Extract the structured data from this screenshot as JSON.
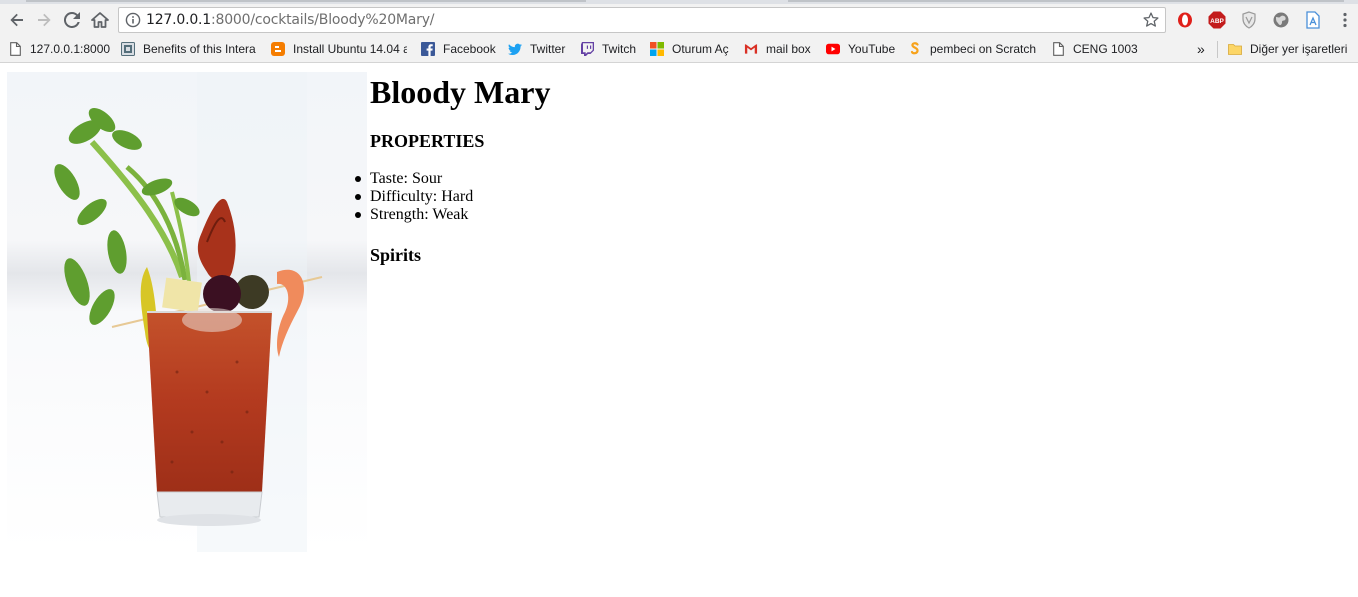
{
  "browser": {
    "url_host": "127.0.0.1",
    "url_rest": ":8000/cocktails/Bloody%20Mary/",
    "bookmarks": [
      {
        "label": "127.0.0.1:8000",
        "icon": "page-icon"
      },
      {
        "label": "Benefits of this Intera",
        "icon": "site-icon"
      },
      {
        "label": "Install Ubuntu 14.04 a",
        "icon": "blogger-icon"
      },
      {
        "label": "Facebook",
        "icon": "facebook-icon"
      },
      {
        "label": "Twitter",
        "icon": "twitter-icon"
      },
      {
        "label": "Twitch",
        "icon": "twitch-icon"
      },
      {
        "label": "Oturum Aç",
        "icon": "microsoft-icon"
      },
      {
        "label": "mail box",
        "icon": "gmail-icon"
      },
      {
        "label": "YouTube",
        "icon": "youtube-icon"
      },
      {
        "label": "pembeci on Scratch",
        "icon": "scratch-icon"
      },
      {
        "label": "CENG 1003",
        "icon": "page-icon"
      }
    ],
    "overflow_label": "»",
    "other_bookmarks": "Diğer yer işaretleri"
  },
  "cocktail": {
    "name": "Bloody Mary",
    "properties_heading": "PROPERTIES",
    "properties": [
      {
        "text": "Taste: Sour"
      },
      {
        "text": "Difficulty: Hard"
      },
      {
        "text": "Strength: Weak"
      }
    ],
    "spirits_heading": "Spirits"
  },
  "colors": {
    "chrome_bg": "#f2f2f2",
    "drink_red": "#b33a1f",
    "celery_green": "#5f9e2f"
  }
}
